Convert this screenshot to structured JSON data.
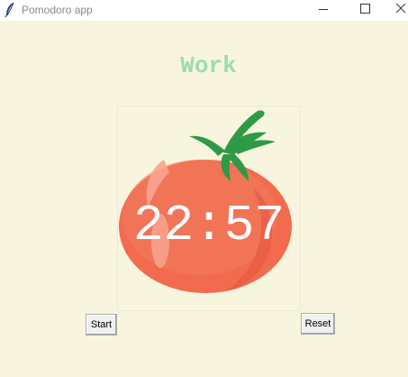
{
  "window": {
    "title": "Pomodoro app",
    "icon": "feather-icon",
    "controls": [
      "minimize-icon",
      "maximize-icon",
      "close-icon"
    ]
  },
  "main": {
    "mode_label": "Work",
    "timer_text": "22:57",
    "image": "tomato-image",
    "start_label": "Start",
    "reset_label": "Reset"
  },
  "colors": {
    "background": "#f7f5dd",
    "mode_label": "#9bdeac",
    "tomato": "#f26b4f",
    "leaves": "#2f9a45",
    "timer_text": "#ffffff"
  }
}
